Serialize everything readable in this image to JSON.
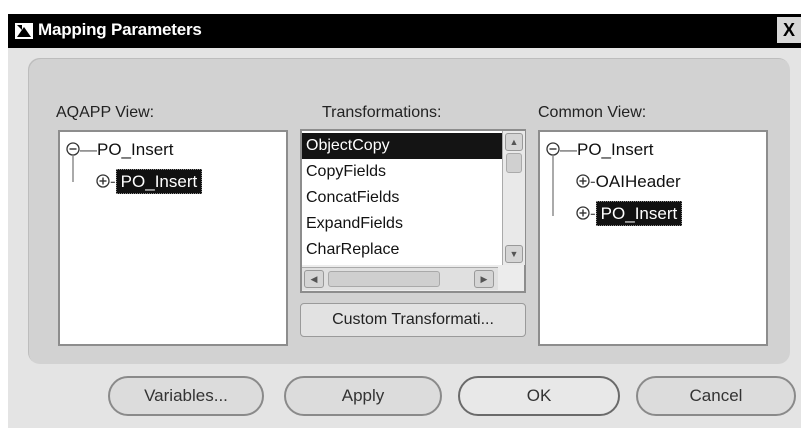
{
  "window": {
    "title": "Mapping Parameters",
    "close_label": "X"
  },
  "columns": {
    "left_label": "AQAPP View:",
    "middle_label": "Transformations:",
    "right_label": "Common View:"
  },
  "left_tree": {
    "root": "PO_Insert",
    "child": "PO_Insert"
  },
  "transformations": {
    "items": [
      "ObjectCopy",
      "CopyFields",
      "ConcatFields",
      "ExpandFields",
      "CharReplace"
    ],
    "selected": "ObjectCopy",
    "custom_button_label": "Custom Transformati..."
  },
  "right_tree": {
    "root": "PO_Insert",
    "children": [
      "OAIHeader",
      "PO_Insert"
    ],
    "selected": "PO_Insert"
  },
  "buttons": {
    "variables": "Variables...",
    "apply": "Apply",
    "ok": "OK",
    "cancel": "Cancel"
  },
  "colors": {
    "titlebar": "#000000",
    "panel": "#d2d2d2",
    "selection": "#141414"
  }
}
